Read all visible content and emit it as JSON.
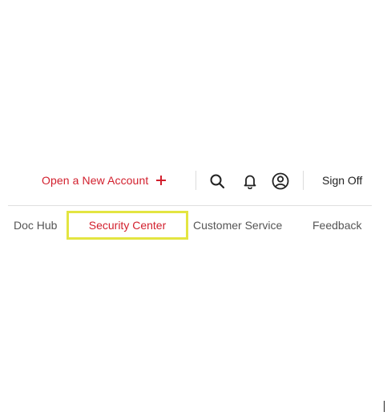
{
  "top_bar": {
    "open_account_label": "Open a New Account",
    "open_account_icon": "plus-icon",
    "search_icon": "search-icon",
    "notification_icon": "bell-icon",
    "profile_icon": "user-circle-icon",
    "sign_off_label": "Sign Off"
  },
  "nav": {
    "items": [
      {
        "label": "Doc Hub"
      },
      {
        "label": "Security Center",
        "highlighted": true
      },
      {
        "label": "Customer Service"
      },
      {
        "label": "Feedback"
      }
    ]
  },
  "colors": {
    "accent_red": "#d21f2d",
    "highlight_outline": "#e3e541",
    "nav_text": "#555555",
    "primary_text": "#222222"
  }
}
